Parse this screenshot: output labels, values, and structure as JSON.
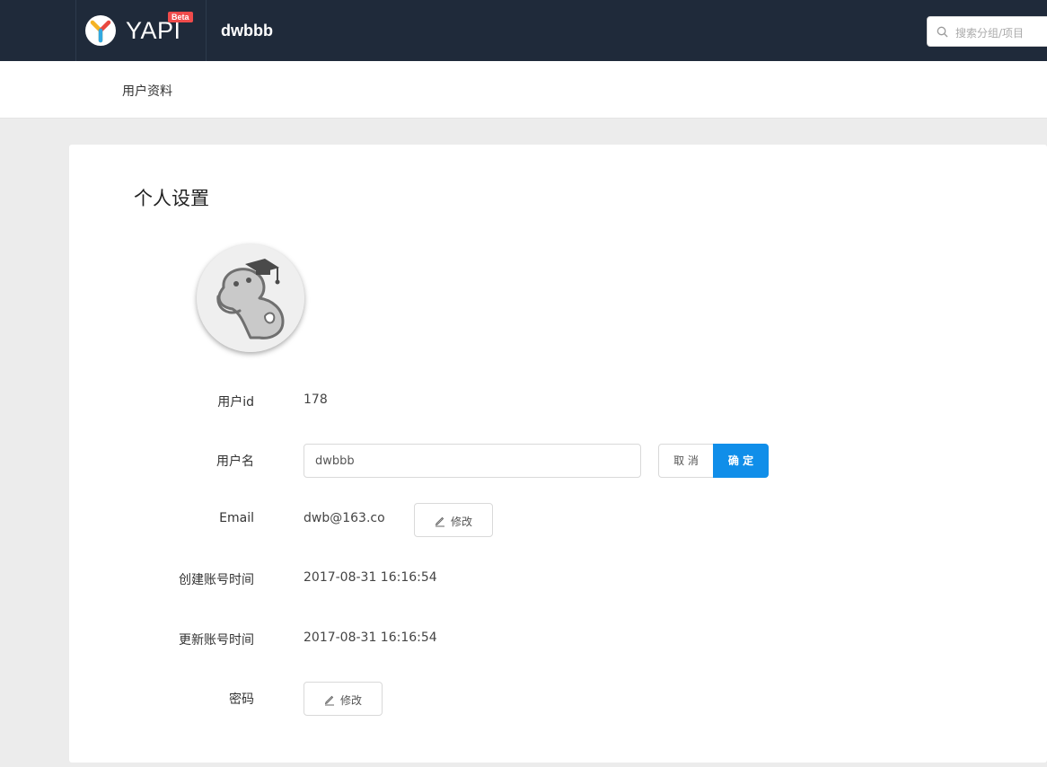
{
  "app": {
    "logo_text": "YAPI",
    "beta_badge": "Beta",
    "breadcrumb": "dwbbb",
    "search_placeholder": "搜索分组/项目"
  },
  "subnav": {
    "item": "用户资料"
  },
  "profile": {
    "title": "个人设置",
    "fields": {
      "user_id_label": "用户id",
      "user_id_value": "178",
      "username_label": "用户名",
      "username_value": "dwbbb",
      "cancel_label": "取 消",
      "confirm_label": "确 定",
      "email_label": "Email",
      "email_value": "dwb@163.co",
      "email_edit_label": "修改",
      "created_label": "创建账号时间",
      "created_value": "2017-08-31 16:16:54",
      "updated_label": "更新账号时间",
      "updated_value": "2017-08-31 16:16:54",
      "password_label": "密码",
      "password_edit_label": "修改"
    }
  },
  "colors": {
    "topbar": "#1f2a3a",
    "primary": "#108ee9",
    "beta": "#ef4b4b",
    "page_bg": "#ececec"
  }
}
